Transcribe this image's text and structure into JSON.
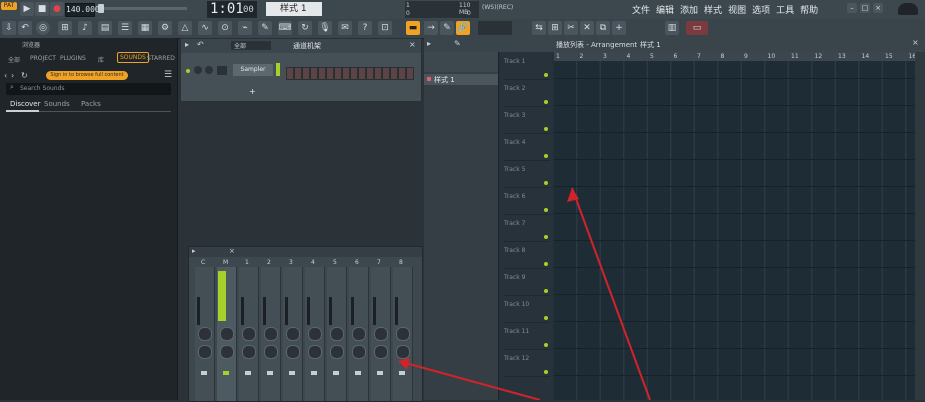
{
  "topbar": {
    "pat_label": "PAT",
    "tempo": "140.000",
    "time_main": "1:01",
    "time_sub": "00",
    "pattern_selector": "样式 1",
    "cpu_value_1": "1",
    "cpu_value_2": "0",
    "mem": "110 MB",
    "mem_value": "0",
    "hint_label": "(WS)(REC)",
    "menu": [
      "文件",
      "编辑",
      "添加",
      "样式",
      "视图",
      "选项",
      "工具",
      "帮助"
    ]
  },
  "browser": {
    "title": "浏览器",
    "tabs": [
      "全部",
      "PROJECT",
      "PLUGINS",
      "库",
      "SOUNDS",
      "STARRED"
    ],
    "active_tab": "SOUNDS",
    "signin_label": "Sign in to browse full content",
    "search_placeholder": "Search Sounds",
    "subtabs": [
      "Discover",
      "Sounds",
      "Packs"
    ]
  },
  "channel_rack": {
    "filter": "全部",
    "title": "通道机架",
    "channel_name": "Sampler",
    "add_label": "+"
  },
  "playlist": {
    "title": "播放列表 - Arrangement",
    "pattern_label": "样式 1",
    "pattern_item": "样式 1",
    "ruler": [
      "1",
      "2",
      "3",
      "4",
      "5",
      "6",
      "7",
      "8",
      "9",
      "10",
      "11",
      "12",
      "13",
      "14",
      "15",
      "16"
    ],
    "tracks": [
      "Track 1",
      "Track 2",
      "Track 3",
      "Track 4",
      "Track 5",
      "Track 6",
      "Track 7",
      "Track 8",
      "Track 9",
      "Track 10",
      "Track 11",
      "Track 12"
    ]
  },
  "mixer": {
    "master_label": "M",
    "labels": [
      "C",
      "M",
      "1",
      "2",
      "3",
      "4",
      "5",
      "6",
      "7",
      "8"
    ]
  },
  "colors": {
    "accent_orange": "#f0a224",
    "active_green": "#a6d12a",
    "arrow_red": "#d2232a"
  }
}
